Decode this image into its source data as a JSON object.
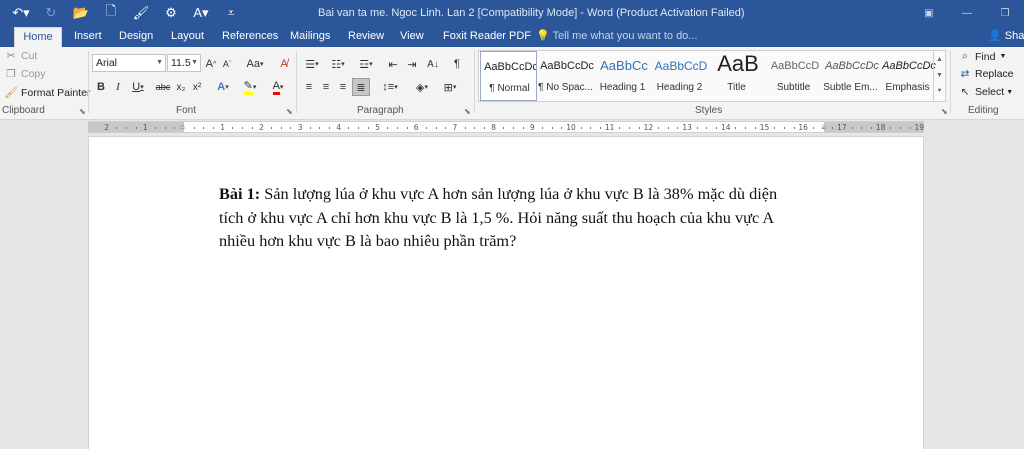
{
  "quick_access": [
    {
      "name": "undo-icon",
      "glyph": "↶▾"
    },
    {
      "name": "redo-icon",
      "glyph": "↻"
    },
    {
      "name": "open-folder-icon",
      "glyph": "📂"
    },
    {
      "name": "new-document-icon",
      "glyph": "🗋"
    },
    {
      "name": "format-painter-qat-icon",
      "glyph": "🖌"
    },
    {
      "name": "clear-formatting-qat-icon",
      "glyph": "⚙"
    },
    {
      "name": "font-color-qat-icon",
      "glyph": "A▾"
    },
    {
      "name": "customize-qat-icon",
      "glyph": "⩡"
    }
  ],
  "window": {
    "title": "Bai van ta me. Ngoc Linh. Lan 2 [Compatibility Mode] - Word (Product Activation Failed)"
  },
  "tabs": [
    "Home",
    "Insert",
    "Design",
    "Layout",
    "References",
    "Mailings",
    "Review",
    "View",
    "Foxit Reader PDF"
  ],
  "tell_me": "Tell me what you want to do...",
  "share_label": "Share",
  "clipboard": {
    "cut": "Cut",
    "copy": "Copy",
    "format_painter": "Format Painter",
    "label": "Clipboard"
  },
  "font": {
    "name": "Arial",
    "size": "11.5",
    "label": "Font",
    "grow": "A",
    "shrink": "A",
    "case": "Aa",
    "bold": "B",
    "italic": "I",
    "underline": "U",
    "strike": "abc",
    "subscript": "x₂",
    "superscript": "x²",
    "text_effects": "A",
    "highlight_color": "#ffff00",
    "font_color": "#ff0000"
  },
  "paragraph": {
    "label": "Paragraph"
  },
  "styles": {
    "label": "Styles",
    "items": [
      {
        "preview": "AaBbCcDc",
        "name": "¶ Normal"
      },
      {
        "preview": "AaBbCcDc",
        "name": "¶ No Spac..."
      },
      {
        "preview": "AaBbCc",
        "name": "Heading 1"
      },
      {
        "preview": "AaBbCcD",
        "name": "Heading 2"
      },
      {
        "preview": "AaB",
        "name": "Title"
      },
      {
        "preview": "AaBbCcD",
        "name": "Subtitle"
      },
      {
        "preview": "AaBbCcDc",
        "name": "Subtle Em..."
      },
      {
        "preview": "AaBbCcDc",
        "name": "Emphasis"
      }
    ]
  },
  "editing": {
    "label": "Editing",
    "find": "Find",
    "replace": "Replace",
    "select": "Select"
  },
  "ruler": {
    "left_numbers": [
      "2",
      "1"
    ],
    "right_numbers": [
      "1",
      "2",
      "3",
      "4",
      "5",
      "6",
      "7",
      "8",
      "9",
      "10",
      "11",
      "12",
      "13",
      "14",
      "15",
      "16",
      "17",
      "18",
      "19"
    ]
  },
  "document": {
    "lead": "Bài 1:",
    "body": " Sản lượng lúa ở khu vực A hơn sản lượng lúa ở khu vực B là 38% mặc dù diện tích ở khu vực A chỉ hơn khu vực B là 1,5 %. Hỏi năng suất thu hoạch của khu vực A nhiều hơn khu vực B là bao nhiêu phần trăm?"
  },
  "colors": {
    "title_bar": "#2b579a",
    "ribbon": "#f3f3f3",
    "canvas": "#e6e6e6"
  }
}
